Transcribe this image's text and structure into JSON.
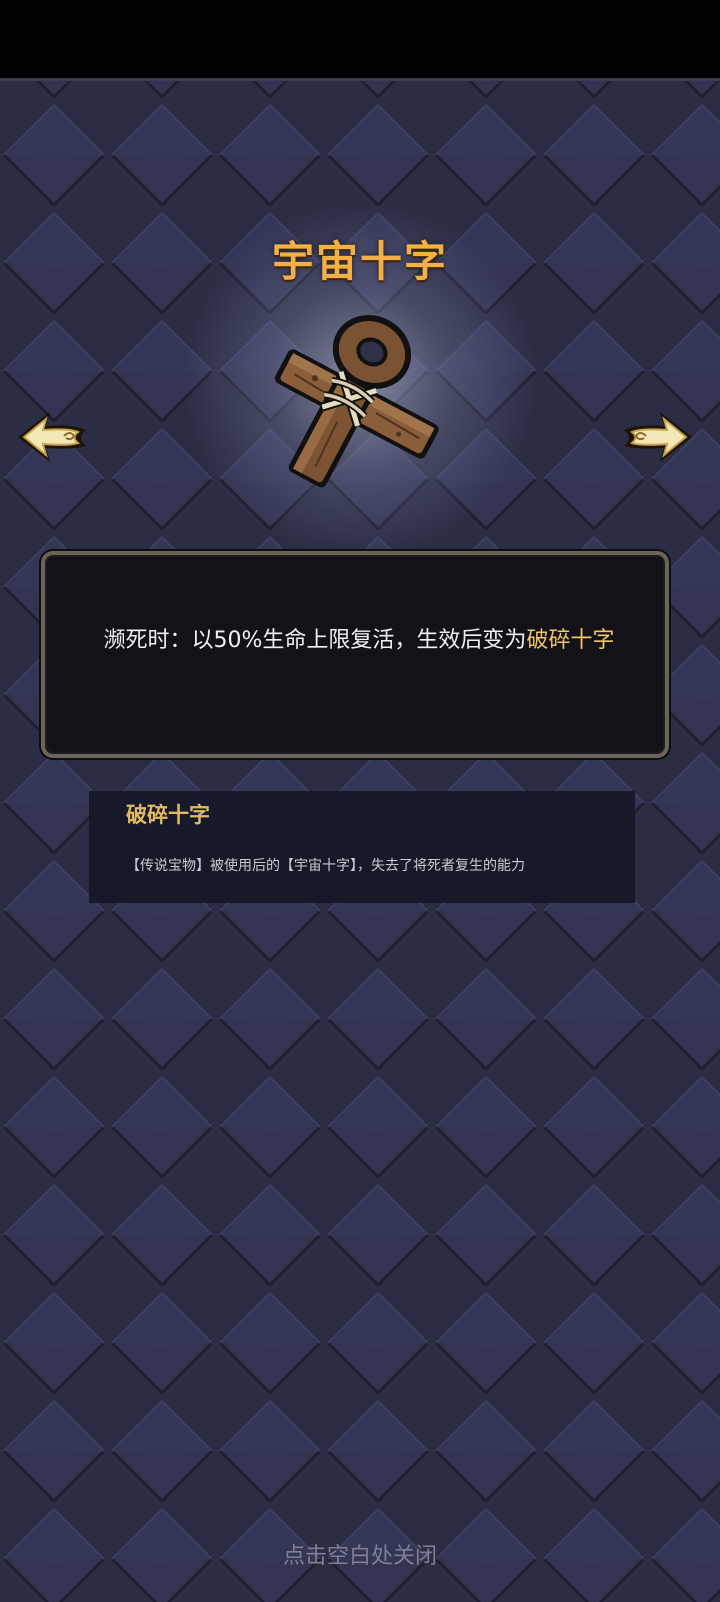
{
  "item": {
    "title": "宇宙十字",
    "icon": "wooden-ankh-icon"
  },
  "navigation": {
    "prev_icon": "arrow-left-icon",
    "next_icon": "arrow-right-icon"
  },
  "effect": {
    "text_before": "濒死时：以50%生命上限复活，生效后变为",
    "highlight": "破碎十字"
  },
  "related": {
    "title": "破碎十字",
    "description": "【传说宝物】被使用后的【宇宙十字】，失去了将死者复生的能力"
  },
  "footer": {
    "close_hint": "点击空白处关闭"
  },
  "colors": {
    "title": "#f3b046",
    "highlight": "#f0c667",
    "background": "#2b2d45"
  }
}
